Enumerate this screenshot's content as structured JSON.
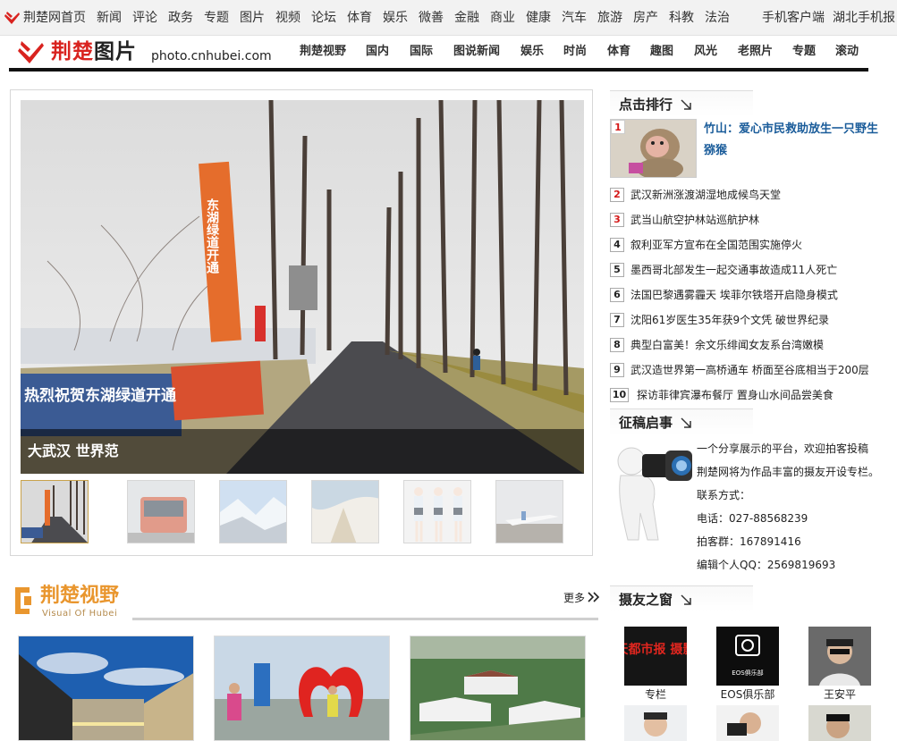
{
  "top_links": [
    "荆楚网首页",
    "新闻",
    "评论",
    "政务",
    "专题",
    "图片",
    "视频",
    "论坛",
    "体育",
    "娱乐",
    "微善",
    "金融",
    "商业",
    "健康",
    "汽车",
    "旅游",
    "房产",
    "科教",
    "法治",
    "手机客户端",
    "湖北手机报"
  ],
  "brand": {
    "name_red": "荆楚",
    "name_dark": "图片",
    "domain": "photo.cnhubei.com"
  },
  "nav": [
    "荆楚视野",
    "国内",
    "国际",
    "图说新闻",
    "娱乐",
    "时尚",
    "体育",
    "趣图",
    "风光",
    "老照片",
    "专题",
    "滚动"
  ],
  "slideshow": {
    "caption": "大武汉 世界范",
    "banner_text": "热烈祝贺东湖绿道开通",
    "flag_text": "东湖绿道开通"
  },
  "ranking": {
    "title": "点击排行",
    "top_item": {
      "rank": "1",
      "text": "竹山：爱心市民救助放生一只野生猕猴"
    },
    "items": [
      {
        "rank": "2",
        "text": "武汉新洲涨渡湖湿地成候鸟天堂"
      },
      {
        "rank": "3",
        "text": "武当山航空护林站巡航护林"
      },
      {
        "rank": "4",
        "text": "叙利亚军方宣布在全国范围实施停火"
      },
      {
        "rank": "5",
        "text": "墨西哥北部发生一起交通事故造成11人死亡"
      },
      {
        "rank": "6",
        "text": "法国巴黎遇雾霾天 埃菲尔铁塔开启隐身模式"
      },
      {
        "rank": "7",
        "text": "沈阳61岁医生35年获9个文凭 破世界纪录"
      },
      {
        "rank": "8",
        "text": "典型白富美！余文乐绯闻女友系台湾嫩模"
      },
      {
        "rank": "9",
        "text": "武汉造世界第一高桥通车 桥面至谷底相当于200层"
      },
      {
        "rank": "10",
        "text": "探访菲律宾瀑布餐厅 置身山水间品尝美食"
      }
    ]
  },
  "contribution": {
    "title": "征稿启事",
    "lines": [
      "一个分享展示的平台，欢迎拍客投稿",
      "荆楚网将为作品丰富的摄友开设专栏。",
      "联系方式：",
      "电话：027-88568239",
      "拍客群：167891416",
      "编辑个人QQ：2569819693"
    ]
  },
  "vision": {
    "title": "荆楚视野",
    "subtitle": "Visual Of Hubei",
    "more": "更多"
  },
  "friends": {
    "title": "摄友之窗",
    "items": [
      {
        "label": "专栏",
        "img_text": "楚天都市报 摄影部"
      },
      {
        "label": "EOS俱乐部",
        "img_text": "EOS俱乐部"
      },
      {
        "label": "王安平"
      }
    ]
  },
  "colors": {
    "brand_red": "#d9231f",
    "rank_red": "#d41717",
    "link_blue": "#1a5c9a",
    "vision_orange": "#e9962e"
  }
}
